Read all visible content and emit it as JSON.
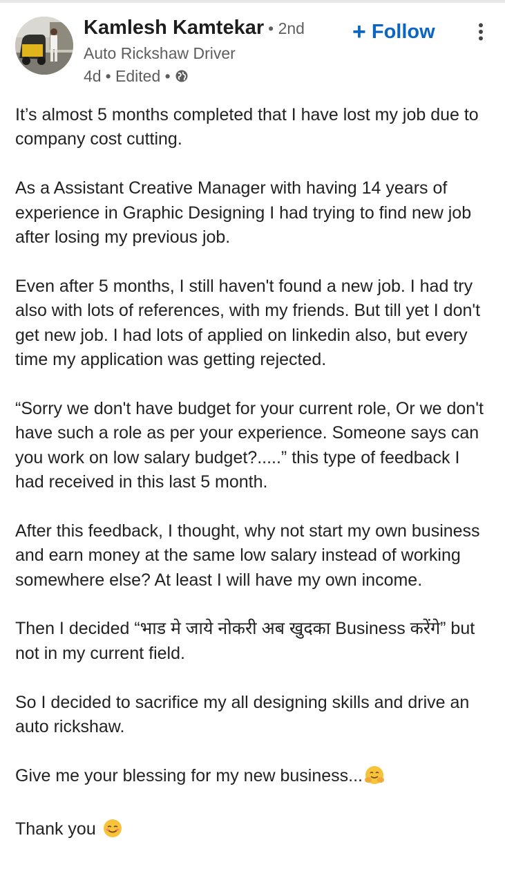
{
  "post": {
    "author": {
      "name": "Kamlesh Kamtekar",
      "degree": "• 2nd",
      "headline": "Auto Rickshaw Driver",
      "age": "4d",
      "edited": "• Edited •",
      "visibility_icon": "globe-icon",
      "avatar_icon": "avatar-photo"
    },
    "follow_label": "Follow",
    "follow_icon": "plus-icon",
    "more_icon": "vertical-ellipsis-icon",
    "accent_color": "#0a66c2",
    "paragraphs": [
      "It’s almost 5 months completed that I have lost my job due to company cost cutting.",
      "As a Assistant Creative Manager with having 14 years of experience in Graphic Designing I had trying to find new job after losing my previous job.",
      "Even after 5 months, I still haven't found a new job. I had try also with lots of references, with my friends. But till yet I don't get new job. I had lots of applied on linkedin also, but every time my application was getting rejected.",
      "“Sorry we don't have budget for your current role, Or we don't have such a role as per your experience. Someone says can you work on low salary budget?.....” this type of feedback I had received in this last 5 month.",
      "After this feedback, I thought, why not start my own business and earn money at the same low salary instead of working somewhere else? At least I will have my own income.",
      "Then I decided “भाड मे जाये नोकरी अब खुदका Business करेंगे” but not in my current field.",
      "So I decided to sacrifice my all designing skills and drive an auto rickshaw."
    ],
    "blessing_text": "Give me your blessing for my new business...",
    "blessing_emoji": "hugging-face-emoji",
    "thanks_text": "Thank you",
    "thanks_emoji": "smiling-face-emoji"
  }
}
